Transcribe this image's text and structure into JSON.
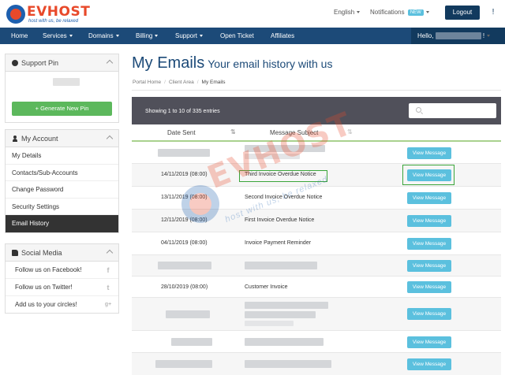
{
  "header": {
    "logo_text": "EVHOST",
    "logo_tagline": "host with us, be relaxed",
    "language": "English",
    "notifications": "Notifications",
    "notifications_badge": "NEW",
    "logout": "Logout",
    "alert_icon": "!"
  },
  "nav": {
    "items": [
      "Home",
      "Services",
      "Domains",
      "Billing",
      "Support",
      "Open Ticket",
      "Affiliates"
    ],
    "hello": "Hello,",
    "hello_suffix": "!"
  },
  "sidebar": {
    "support_pin": {
      "title": "Support Pin",
      "button": "+ Generate New Pin"
    },
    "account": {
      "title": "My Account",
      "items": [
        "My Details",
        "Contacts/Sub-Accounts",
        "Change Password",
        "Security Settings",
        "Email History"
      ]
    },
    "social": {
      "title": "Social Media",
      "items": [
        "Follow us on Facebook!",
        "Follow us on Twitter!",
        "Add us to your circles!"
      ],
      "icons": [
        "f",
        "t",
        "g+"
      ]
    }
  },
  "main": {
    "title": "My Emails",
    "subtitle": "Your email history with us",
    "breadcrumb": [
      "Portal Home",
      "Client Area",
      "My Emails"
    ],
    "entries_info": "Showing 1 to 10 of 335 entries",
    "columns": [
      "Date Sent",
      "Message Subject"
    ],
    "view_label": "View Message",
    "rows": [
      {
        "date": "",
        "subject": ""
      },
      {
        "date": "14/11/2019 (08:00)",
        "subject": "Third Invoice Overdue Notice"
      },
      {
        "date": "13/11/2019 (08:00)",
        "subject": "Second Invoice Overdue Notice"
      },
      {
        "date": "12/11/2019 (08:00)",
        "subject": "First Invoice Overdue Notice"
      },
      {
        "date": "04/11/2019 (08:00)",
        "subject": "Invoice Payment Reminder"
      },
      {
        "date": "",
        "subject": ""
      },
      {
        "date": "28/10/2019 (08:00)",
        "subject": "Customer Invoice"
      },
      {
        "date": "",
        "subject": ""
      },
      {
        "date": "",
        "subject": ""
      },
      {
        "date": "",
        "subject": ""
      }
    ]
  },
  "watermark": {
    "text": "EVHOST",
    "tagline": "host with us, be relaxed"
  },
  "colors": {
    "nav": "#1c4a78",
    "logout": "#123a5e",
    "view_button": "#5bc0de",
    "generate_button": "#5cb85c",
    "highlight": "#3aa53a",
    "brand_orange": "#e8492a"
  }
}
